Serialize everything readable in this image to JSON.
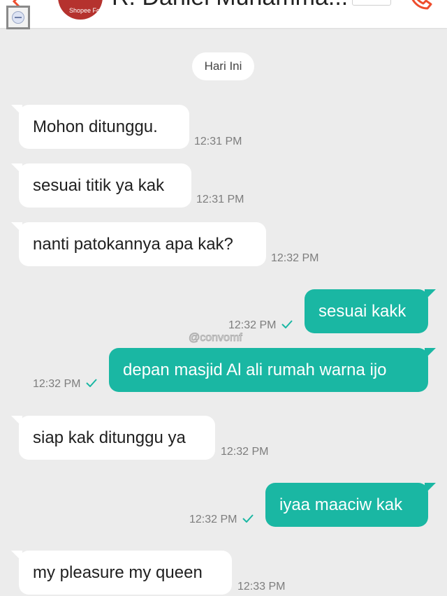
{
  "header": {
    "contact_name": "R. Daniel Muhamma...",
    "avatar_text": "Shopee Food"
  },
  "date_separator": "Hari Ini",
  "watermark": "@convomf",
  "messages": [
    {
      "direction": "incoming",
      "text": "Mohon ditunggu.",
      "time": "12:31 PM"
    },
    {
      "direction": "incoming",
      "text": "sesuai titik ya kak",
      "time": "12:31 PM"
    },
    {
      "direction": "incoming",
      "text": "nanti patokannya apa kak?",
      "time": "12:32 PM"
    },
    {
      "direction": "outgoing",
      "text": "sesuai kakk",
      "time": "12:32 PM",
      "status": "sent"
    },
    {
      "direction": "outgoing",
      "text": "depan masjid Al ali rumah warna ijo",
      "time": "12:32 PM",
      "status": "sent"
    },
    {
      "direction": "incoming",
      "text": "siap kak ditunggu ya",
      "time": "12:32 PM"
    },
    {
      "direction": "outgoing",
      "text": "iyaa maaciw kak",
      "time": "12:32 PM",
      "status": "sent"
    },
    {
      "direction": "incoming",
      "text": "my pleasure my queen",
      "time": "12:33 PM"
    }
  ],
  "colors": {
    "background": "#ececec",
    "outgoing_bubble": "#1ab7a3",
    "incoming_bubble": "#ffffff",
    "brand_orange": "#ee4d2d",
    "check": "#1ab7a3"
  }
}
